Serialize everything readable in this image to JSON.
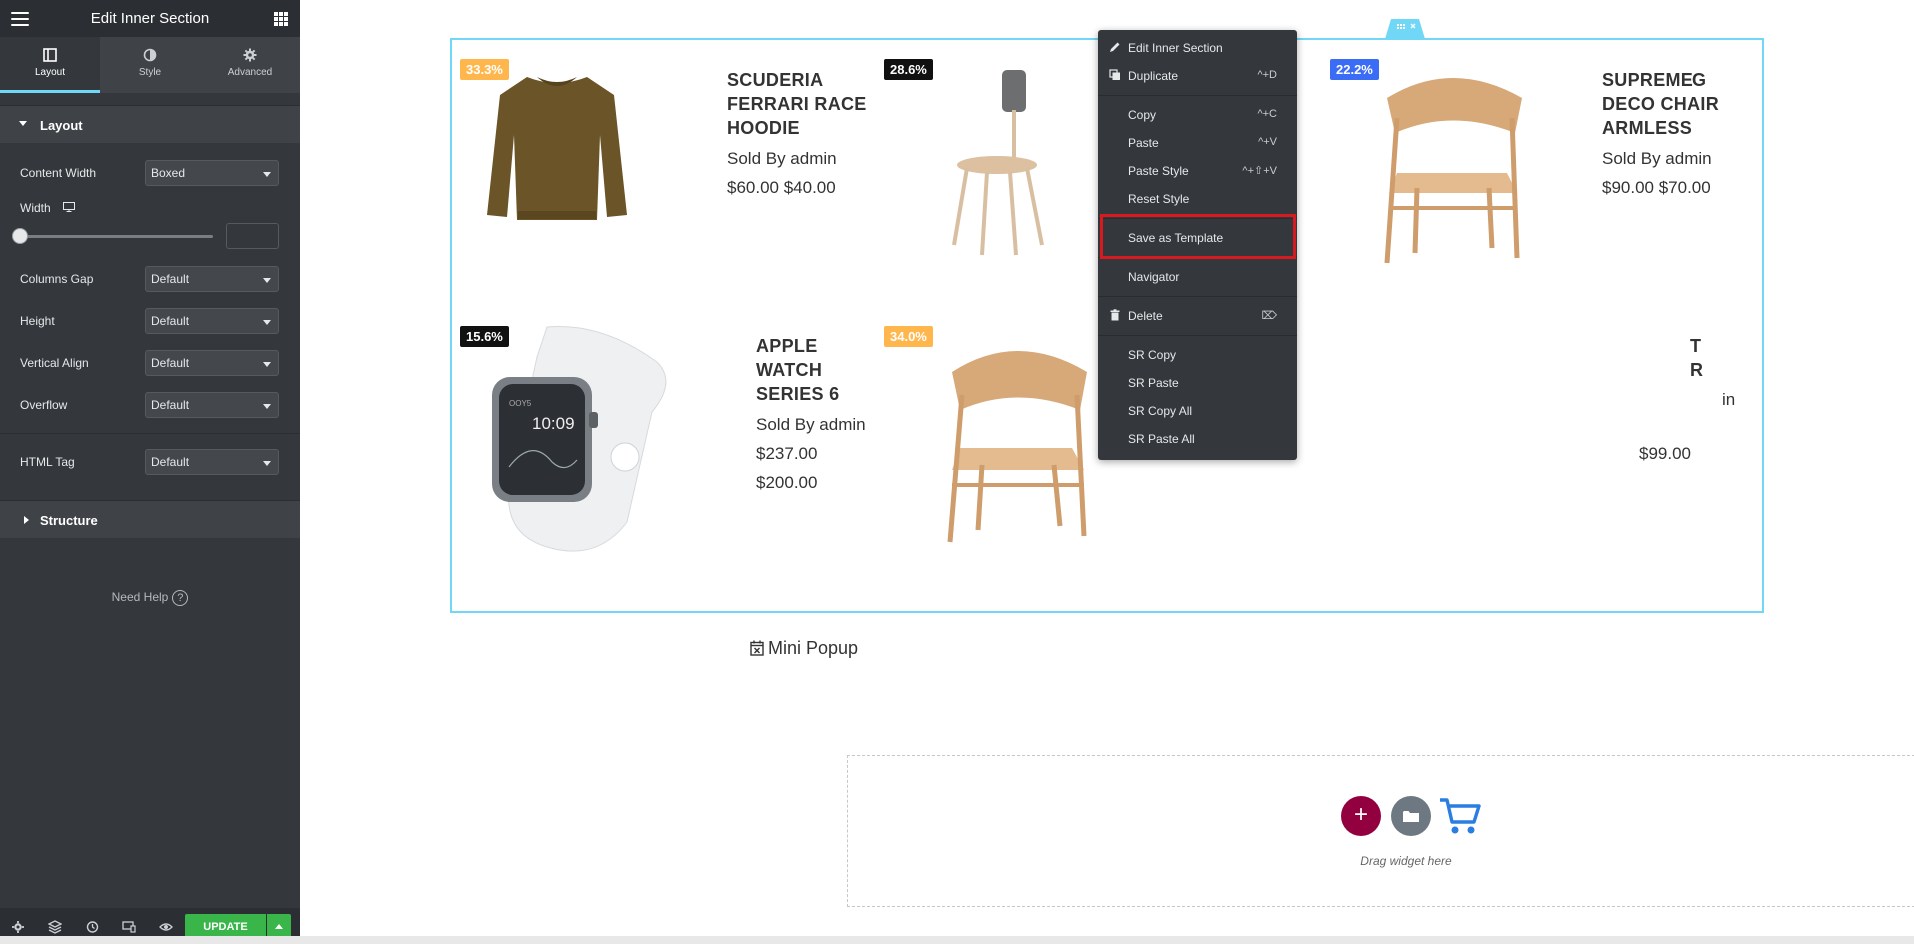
{
  "panel": {
    "title": "Edit Inner Section",
    "tabs": [
      {
        "label": "Layout",
        "icon": "layout-icon"
      },
      {
        "label": "Style",
        "icon": "half-circle-icon"
      },
      {
        "label": "Advanced",
        "icon": "gear-icon"
      }
    ],
    "layout_section": "Layout",
    "controls": {
      "content_width": {
        "label": "Content Width",
        "value": "Boxed"
      },
      "width": {
        "label": "Width",
        "value": ""
      },
      "columns_gap": {
        "label": "Columns Gap",
        "value": "Default"
      },
      "height": {
        "label": "Height",
        "value": "Default"
      },
      "vertical_align": {
        "label": "Vertical Align",
        "value": "Default"
      },
      "overflow": {
        "label": "Overflow",
        "value": "Default"
      },
      "html_tag": {
        "label": "HTML Tag",
        "value": "Default"
      }
    },
    "structure_section": "Structure",
    "help": {
      "label": "Need Help",
      "glyph": "?"
    },
    "footer": {
      "update_label": "UPDATE"
    }
  },
  "products": [
    {
      "badge": "33.3%",
      "title_lines": [
        "SCUDERIA",
        "FERRARI RACE",
        "HOODIE"
      ],
      "seller": "Sold By admin",
      "price": "$60.00 $40.00"
    },
    {
      "badge": "28.6%",
      "title_lines": [
        "G"
      ]
    },
    {
      "badge": "22.2%",
      "title_lines": [
        "SUPREME",
        "DECO CHAIR",
        "ARMLESS"
      ],
      "seller": "Sold By admin",
      "price": "$90.00 $70.00"
    },
    {
      "badge": "15.6%",
      "title_lines": [
        "APPLE",
        "WATCH",
        "SERIES 6"
      ],
      "seller": "Sold By admin",
      "price_old": "$237.00",
      "price_new": "$200.00"
    },
    {
      "badge": "34.0%",
      "title_lines": [
        "T",
        "R"
      ],
      "seller_tail": "in",
      "price_tail": "$99.00"
    }
  ],
  "watch_face": {
    "brand": "OOY5",
    "time": "10:09"
  },
  "mini_popup": "Mini Popup",
  "dropzone": {
    "add_glyph": "+",
    "text": "Drag widget here"
  },
  "context_menu": [
    {
      "label": "Edit Inner Section",
      "shortcut": "",
      "icon": "pencil-icon"
    },
    {
      "label": "Duplicate",
      "shortcut": "^+D",
      "icon": "duplicate-icon"
    },
    {
      "label": "Copy",
      "shortcut": "^+C",
      "icon": ""
    },
    {
      "label": "Paste",
      "shortcut": "^+V",
      "icon": ""
    },
    {
      "label": "Paste Style",
      "shortcut": "^+⇧+V",
      "icon": ""
    },
    {
      "label": "Reset Style",
      "shortcut": "",
      "icon": ""
    },
    {
      "label": "Save as Template",
      "shortcut": "",
      "icon": ""
    },
    {
      "label": "Navigator",
      "shortcut": "",
      "icon": ""
    },
    {
      "label": "Delete",
      "shortcut": "⌦",
      "icon": "trash-icon"
    },
    {
      "label": "SR Copy",
      "shortcut": "",
      "icon": ""
    },
    {
      "label": "SR Paste",
      "shortcut": "",
      "icon": ""
    },
    {
      "label": "SR Copy All",
      "shortcut": "",
      "icon": ""
    },
    {
      "label": "SR Paste All",
      "shortcut": "",
      "icon": ""
    }
  ],
  "colors": {
    "panel_bg": "#34383c",
    "accent_blue": "#71d7f7",
    "update_green": "#39b54a",
    "badge_orange": "#ffb74d",
    "badge_blue": "#3b6cf6",
    "highlight_red": "#d71920",
    "add_button": "#93003f"
  }
}
